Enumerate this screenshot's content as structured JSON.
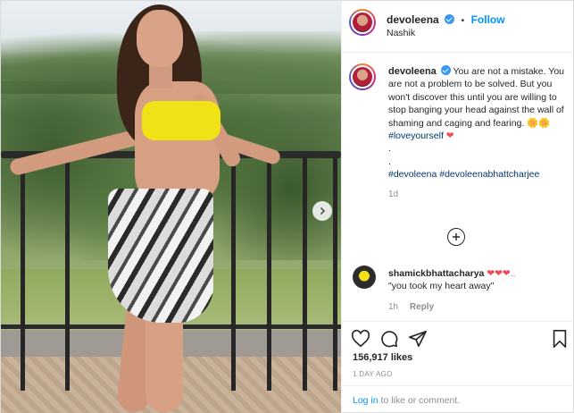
{
  "post": {
    "username": "devoleena",
    "follow_label": "Follow",
    "separator": "•",
    "location": "Nashik"
  },
  "caption": {
    "username": "devoleena",
    "text": "You are not a mistake. You are not a problem to be solved. But you won't discover this until you are willing to stop banging your head against the wall of shaming and caging and fearing.",
    "emoji": "🌼🌼",
    "hashtag1": "#loveyourself",
    "heart": "❤",
    "dot1": ".",
    "dot2": ".",
    "tags": [
      "#devoleena",
      "#devoleenabhattcharjee"
    ],
    "time": "1d"
  },
  "comment": {
    "username": "shamickbhattacharya",
    "hearts": "❤❤❤..",
    "text": "\"you took my heart away\"",
    "time": "1h",
    "reply_label": "Reply"
  },
  "stats": {
    "likes": "156,917 likes",
    "date": "1 DAY AGO"
  },
  "login": {
    "link": "Log in",
    "rest": " to like or comment."
  },
  "icons": {
    "like": "heart-icon",
    "comment": "comment-icon",
    "share": "share-icon",
    "save": "bookmark-icon",
    "more": "plus-circle-icon",
    "next": "chevron-right-icon"
  },
  "colors": {
    "accent": "#0095f6",
    "verified": "#3897f0",
    "hashtag": "#00376b",
    "heart": "#ed4956"
  }
}
